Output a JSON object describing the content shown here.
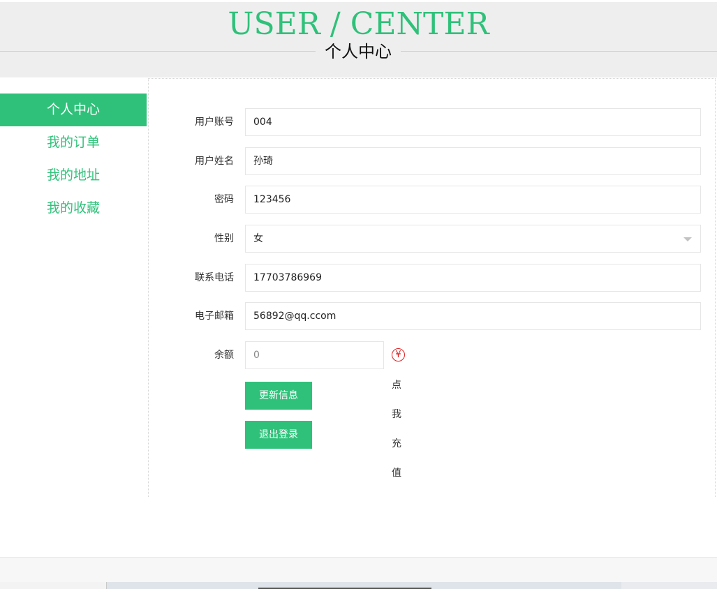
{
  "header": {
    "title_en": "USER / CENTER",
    "title_cn": "个人中心"
  },
  "sidebar": {
    "items": [
      {
        "label": "个人中心",
        "active": true
      },
      {
        "label": "我的订单",
        "active": false
      },
      {
        "label": "我的地址",
        "active": false
      },
      {
        "label": "我的收藏",
        "active": false
      }
    ]
  },
  "form": {
    "account": {
      "label": "用户账号",
      "value": "004"
    },
    "name": {
      "label": "用户姓名",
      "value": "孙琦"
    },
    "password": {
      "label": "密码",
      "value": "123456"
    },
    "gender": {
      "label": "性别",
      "value": "女"
    },
    "phone": {
      "label": "联系电话",
      "value": "17703786969"
    },
    "email": {
      "label": "电子邮箱",
      "value": "56892@qq.ccom"
    },
    "balance": {
      "label": "余额",
      "value": "0",
      "recharge_label": "点我充值",
      "recharge_icon": "yen-icon"
    }
  },
  "buttons": {
    "update_label": "更新信息",
    "logout_label": "退出登录"
  },
  "colors": {
    "accent": "#2fc17a",
    "recharge_icon": "#e02020"
  }
}
